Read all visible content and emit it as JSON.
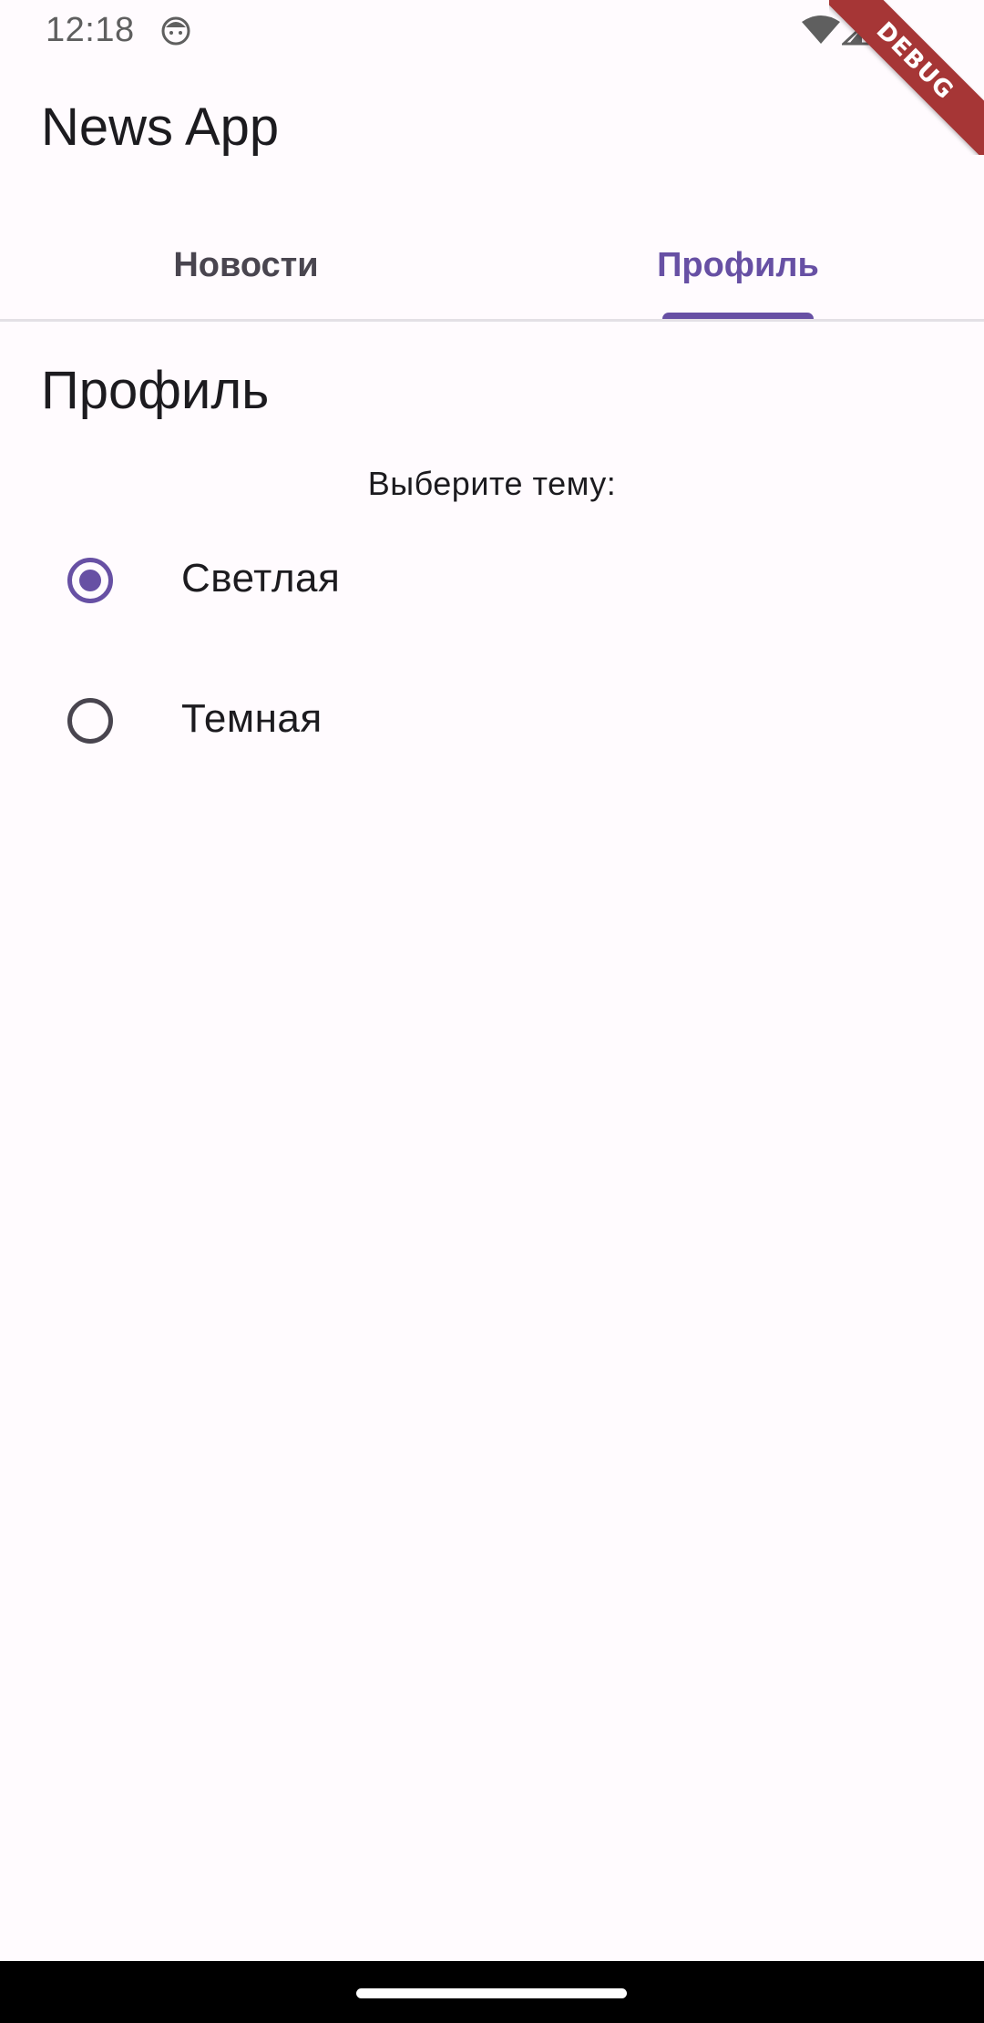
{
  "status_bar": {
    "time": "12:18",
    "app_icon": "android-face-icon",
    "wifi_icon": "wifi-icon",
    "signal_icon": "cell-signal-icon"
  },
  "debug_banner": "DEBUG",
  "app_bar": {
    "title": "News App"
  },
  "tabs": [
    {
      "label": "Новости",
      "selected": false
    },
    {
      "label": "Профиль",
      "selected": true
    }
  ],
  "profile": {
    "title": "Профиль",
    "theme_prompt": "Выберите тему:",
    "options": [
      {
        "label": "Светлая",
        "selected": true
      },
      {
        "label": "Темная",
        "selected": false
      }
    ]
  },
  "colors": {
    "accent": "#6750a4",
    "background": "#fffbfe",
    "text": "#1c1b1f",
    "debug_ribbon": "#a63636"
  }
}
